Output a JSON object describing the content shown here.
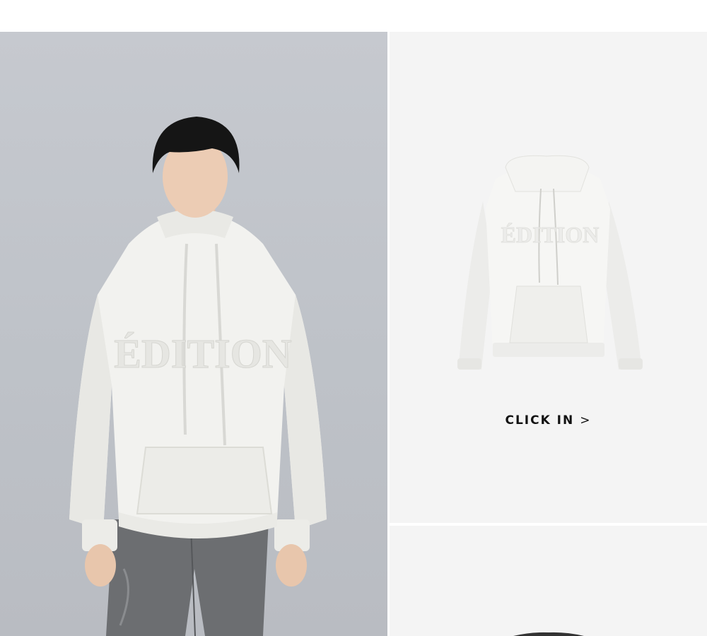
{
  "model_panel": {
    "hoodie_print": "ÉDITION",
    "image": "model-wearing-white-hoodie"
  },
  "product_card": {
    "image": "white-hoodie-flat-lay",
    "hoodie_print": "ÉDITION",
    "cta_label": "CLICK IN",
    "cta_arrow": ">"
  },
  "colors": {
    "model_background": "#c3c6cc",
    "product_background": "#f4f4f4",
    "hoodie": "#f3f3f0",
    "cta_text": "#111111"
  }
}
